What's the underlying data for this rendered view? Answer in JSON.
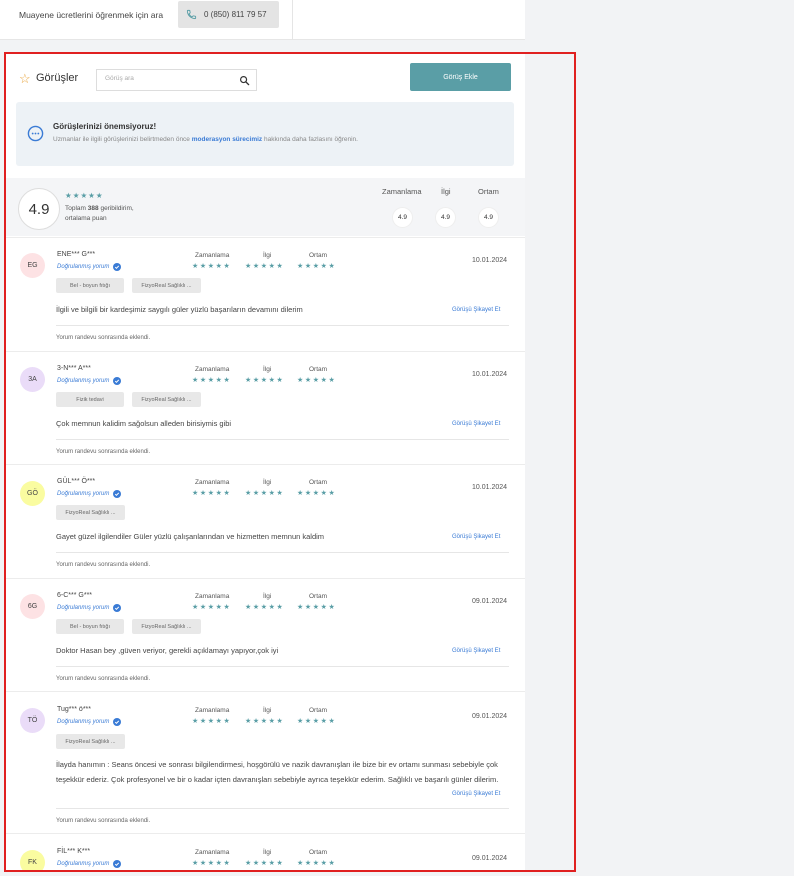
{
  "top": {
    "text": "Muayene ücretlerini öğrenmek için ara",
    "phone": "0 (850) 811 79 57"
  },
  "header": {
    "title": "Görüşler",
    "search_placeholder": "Görüş ara",
    "add_button": "Görüş Ekle"
  },
  "info": {
    "title": "Görüşlerinizi önemsiyoruz!",
    "text_before": "Uzmanlar ile ilgili görüşlerinizi belirtmeden önce ",
    "link": "moderasyon sürecimiz",
    "text_after": " hakkında daha fazlasını öğrenin."
  },
  "summary": {
    "score": "4.9",
    "stars": "★★★★★",
    "total_prefix": "Toplam",
    "total_count": "388",
    "total_suffix": "geribildirim,",
    "avg_label": "ortalama puan",
    "categories": [
      {
        "label": "Zamanlama",
        "value": "4.9"
      },
      {
        "label": "İlgi",
        "value": "4.9"
      },
      {
        "label": "Ortam",
        "value": "4.9"
      }
    ]
  },
  "labels": {
    "verified": "Doğrulanmış yorum",
    "timing": "Zamanlama",
    "care": "İlgi",
    "environment": "Ortam",
    "stars": "★★★★★",
    "complain": "Görüşü Şikayet Et",
    "footnote": "Yorum randevu sonrasında eklendi."
  },
  "reviews": [
    {
      "initials": "EG",
      "color": "#fde2e4",
      "name": "ENE*** G***",
      "date": "10.01.2024",
      "tags": [
        "Bel - boyun fıtığı",
        "FizyoReal Sağlıklı ..."
      ],
      "text": "İlgili ve bilgili bir kardeşimiz saygılı güler yüzlü başarıların devamını dilerim"
    },
    {
      "initials": "3A",
      "color": "#eadcf8",
      "name": "3-N*** A***",
      "date": "10.01.2024",
      "tags": [
        "Fizik tedavi",
        "FizyoReal Sağlıklı ..."
      ],
      "text": "Çok memnun kalidim sağolsun alleden birisiymis gibi"
    },
    {
      "initials": "GÖ",
      "color": "#fafca0",
      "name": "GÜL*** Ö***",
      "date": "10.01.2024",
      "tags": [
        "FizyoReal Sağlıklı ..."
      ],
      "text": "Gayet güzel ilgilendiler Güler yüzlü çalışanlarından ve hizmetten memnun kaldim"
    },
    {
      "initials": "6G",
      "color": "#fde2e4",
      "name": "6-C*** G***",
      "date": "09.01.2024",
      "tags": [
        "Bel - boyun fıtığı",
        "FizyoReal Sağlıklı ..."
      ],
      "text": "Doktor Hasan bey ,güven veriyor, gerekli açıklamayı yapıyor,çok iyi"
    },
    {
      "initials": "TÖ",
      "color": "#eadcf8",
      "name": "Tug*** ö***",
      "date": "09.01.2024",
      "tags": [
        "FizyoReal Sağlıklı ..."
      ],
      "text": "İlayda hanımın : Seans öncesi ve sonrası bilgilendirmesi, hoşgörülü ve nazik davranışları ile bize bir ev ortamı sunması sebebiyle çok teşekkür ederiz. Çok profesyonel ve bir o kadar içten davranışları sebebiyle ayrıca teşekkür ederim. Sağlıklı ve başarılı günler dilerim."
    },
    {
      "initials": "FK",
      "color": "#fafca0",
      "name": "FİL*** K***",
      "date": "09.01.2024",
      "tags": [],
      "text": ""
    }
  ]
}
